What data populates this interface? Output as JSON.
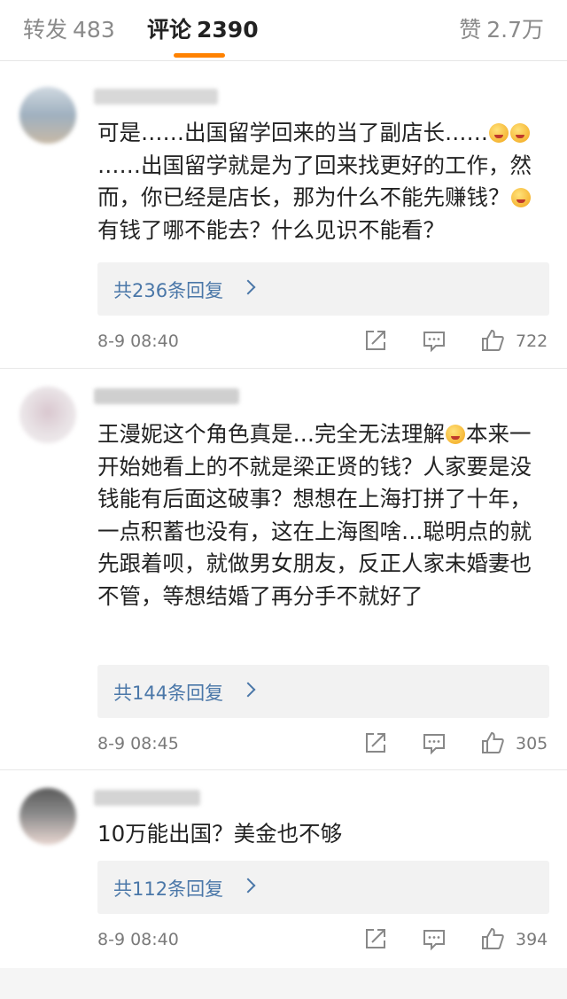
{
  "tabs": {
    "repost": {
      "label": "转发",
      "count": "483"
    },
    "comment": {
      "label": "评论",
      "count": "2390"
    },
    "like": {
      "label": "赞",
      "count": "2.7万"
    }
  },
  "comments": [
    {
      "text_a": "可是……出国留学回来的当了副店长……",
      "text_b": "\n……出国留学就是为了回来找更好的工作，然而，你已经是店长，那为什么不能先赚钱？",
      "text_c": "有钱了哪不能去？什么见识不能看？",
      "emoji_a": [
        "cold-sweat-emoji",
        "savoring-emoji"
      ],
      "emoji_b": [
        "savoring-emoji"
      ],
      "replies": "共236条回复",
      "time": "8-9 08:40",
      "likes": "722"
    },
    {
      "text_a": "王漫妮这个角色真是…完全无法理解",
      "text_b": "本来一开始她看上的不就是梁正贤的钱？人家要是没钱能有后面这破事？想想在上海打拼了十年，一点积蓄也没有，这在上海图啥…聪明点的就先跟着呗，就做男女朋友，反正人家未婚妻也不管，等想结婚了再分手不就好了",
      "emoji_a": [
        "astonished-emoji"
      ],
      "replies": "共144条回复",
      "time": "8-9 08:45",
      "likes": "305"
    },
    {
      "text_a": "10万能出国？美金也不够",
      "replies": "共112条回复",
      "time": "8-9 08:40",
      "likes": "394"
    }
  ],
  "colors": {
    "accent": "#ff8200",
    "link": "#4a77a8",
    "reply_bg": "#f2f2f2",
    "muted_text": "#7a7a7a"
  }
}
